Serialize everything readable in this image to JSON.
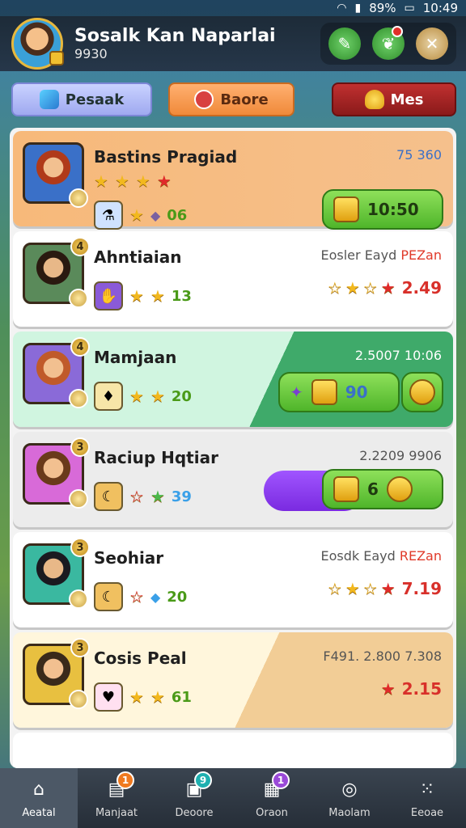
{
  "status_bar": {
    "battery": "89%",
    "time": "10:49"
  },
  "player": {
    "name": "Sosalk Kan Naparlai",
    "score": "9930"
  },
  "tabs": [
    {
      "label": "Pesaak"
    },
    {
      "label": "Baore"
    },
    {
      "label": "Mes"
    }
  ],
  "cards": [
    {
      "name": "Bastins Pragiad",
      "stars": 4,
      "count": "06",
      "info": "75 360",
      "button": "10:50"
    },
    {
      "name": "Ahntiaian",
      "count": "13",
      "info": "Eosler Eayd",
      "info_accent": "PEZan",
      "rating": "2.49"
    },
    {
      "name": "Mamjaan",
      "count": "20",
      "info": "2.5007 10:06",
      "button": "90"
    },
    {
      "name": "Raciup Hqtiar",
      "count": "39",
      "info": "2.2209 9906",
      "button": "6"
    },
    {
      "name": "Seohiar",
      "count": "20",
      "info": "Eosdk Eayd",
      "info_accent": "REZan",
      "rating": "7.19"
    },
    {
      "name": "Cosis Peal",
      "count": "61",
      "info": "F491. 2.800 7.308",
      "rating": "2.15"
    }
  ],
  "nav": [
    {
      "label": "Aeatal",
      "badge": ""
    },
    {
      "label": "Manjaat",
      "badge": "1"
    },
    {
      "label": "Deoore",
      "badge": "9"
    },
    {
      "label": "Oraon",
      "badge": "1"
    },
    {
      "label": "Maolam",
      "badge": ""
    },
    {
      "label": "Eeoae",
      "badge": ""
    }
  ],
  "colors": {
    "accent_green": "#4fb52a",
    "accent_orange": "#f08a3a",
    "accent_red": "#c03030",
    "nav_bg": "#2c3540"
  },
  "icons": [
    "wifi-icon",
    "signal-icon",
    "battery-icon",
    "pencil-icon",
    "leaf-icon",
    "close-icon",
    "gem-icon",
    "alarm-icon",
    "bell-icon",
    "home-icon",
    "book-icon",
    "box-icon",
    "chest-icon",
    "clock-icon",
    "grid-icon"
  ]
}
